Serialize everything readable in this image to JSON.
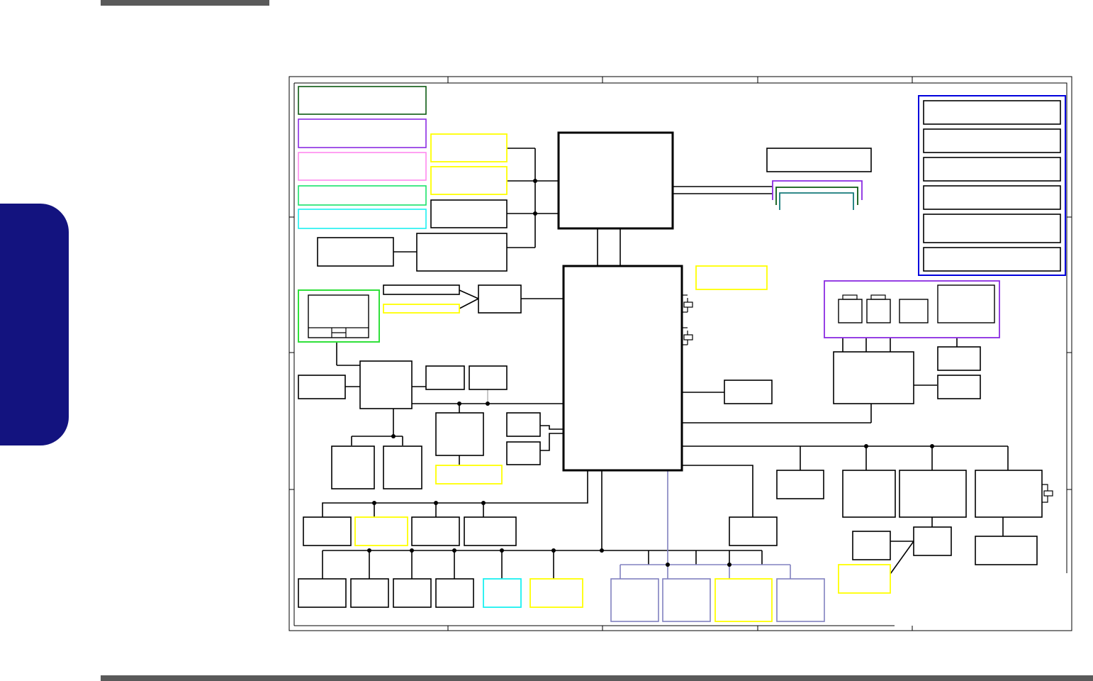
{
  "page": {
    "header_bar_color": "#5a5a5a",
    "footer_bar_color": "#5a5a5a",
    "side_tab_color": "#13137f"
  },
  "diagram": {
    "kind": "block-diagram",
    "labels": [],
    "border_color": "#000000",
    "colors": {
      "dark_green": "#0b5a12",
      "purple": "#8a2be2",
      "pink": "#ff88ee",
      "green": "#19e36a",
      "cyan": "#1cf0f0",
      "yellow": "#ffff00",
      "blue": "#0000dd",
      "teal": "#157a7a",
      "lavender": "#8080c0",
      "bright_green": "#2fe03a"
    }
  }
}
